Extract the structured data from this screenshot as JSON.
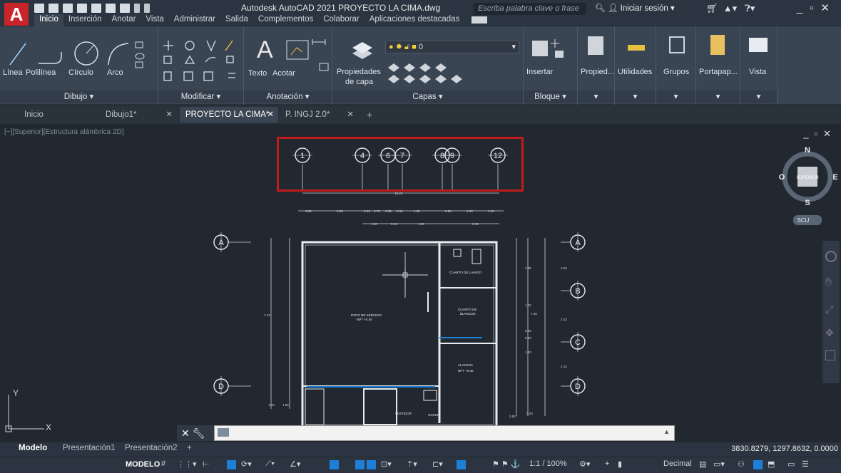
{
  "app": {
    "title": "Autodesk AutoCAD 2021   PROYECTO LA CIMA.dwg",
    "search_placeholder": "Escriba palabra clave o frase",
    "signin_label": "Iniciar sesión",
    "logo_letter": "A"
  },
  "ribbon_tabs": [
    "Inicio",
    "Inserción",
    "Anotar",
    "Vista",
    "Administrar",
    "Salida",
    "Complementos",
    "Colaborar",
    "Aplicaciones destacadas"
  ],
  "ribbon": {
    "draw": {
      "linea": "Línea",
      "polilinea": "Polilínea",
      "circulo": "Círculo",
      "arco": "Arco",
      "group": "Dibujo ▾"
    },
    "modify": {
      "group": "Modificar ▾"
    },
    "annotation": {
      "texto": "Texto",
      "acotar": "Acotar",
      "group": "Anotación ▾"
    },
    "layers": {
      "properties": "Propiedades",
      "properties2": "de capa",
      "layer_value": "0",
      "group": "Capas ▾"
    },
    "block": {
      "insertar": "Insertar",
      "group": "Bloque ▾"
    },
    "extra": [
      "Propied...",
      "Utilidades",
      "Grupos",
      "Portapap...",
      "Vista"
    ]
  },
  "doc_tabs": [
    {
      "label": "Inicio"
    },
    {
      "label": "Dibujo1*"
    },
    {
      "label": "PROYECTO LA CIMA*"
    },
    {
      "label": "P. INGJ 2.0*"
    }
  ],
  "viewport": {
    "label": "[−][Superior][Estructura alámbrica 2D]",
    "viewcube": {
      "n": "N",
      "s": "S",
      "e": "E",
      "o": "O",
      "center": "SUPERIOR",
      "scu": "SCU"
    },
    "ucs": {
      "x": "X",
      "y": "Y"
    },
    "axes_top": [
      "1",
      "4",
      "6",
      "7",
      "8",
      "9",
      "12"
    ],
    "axes_side": [
      "A",
      "B",
      "C",
      "D"
    ],
    "dims": {
      "total": "15.40",
      "row1": [
        "0.92",
        "3.00",
        "0.09",
        "0.75",
        "0.59",
        "0.54",
        "1.30",
        "0.88",
        "1.00",
        "1.00"
      ],
      "row2": [
        "1.50",
        "0.63",
        "1.59",
        "3.33"
      ],
      "left_v": [
        "7.13",
        "1.00",
        "1.95"
      ],
      "right_v": [
        "2.35",
        "2.50",
        "2.43",
        "2.15",
        "7.28",
        "1.00",
        "0.88",
        "0.60",
        "1.00",
        "2.90",
        "0.00"
      ]
    },
    "rooms": {
      "lavado": "CUARTO DE LAVADO",
      "blancos1": "CUARTO DE",
      "blancos2": "BLANCOS",
      "patio": "PATIO DE SERVICIO",
      "patio_npt": "NPT +0.40",
      "alacena": "ALACENA",
      "alacena_npt": "NPT +0.40",
      "cocina": "COCINA",
      "vestidor": "VESTIDOR"
    }
  },
  "layout_tabs": [
    "Modelo",
    "Presentación1",
    "Presentación2"
  ],
  "coordinates": "3830.8279, 1297.8632, 0.0000",
  "statusbar": {
    "model": "MODELO",
    "scale": "1:1 / 100%",
    "units": "Decimal"
  },
  "colors": {
    "accent_red": "#c11b1b",
    "bg": "#212830",
    "ribbon": "#3a4553"
  }
}
